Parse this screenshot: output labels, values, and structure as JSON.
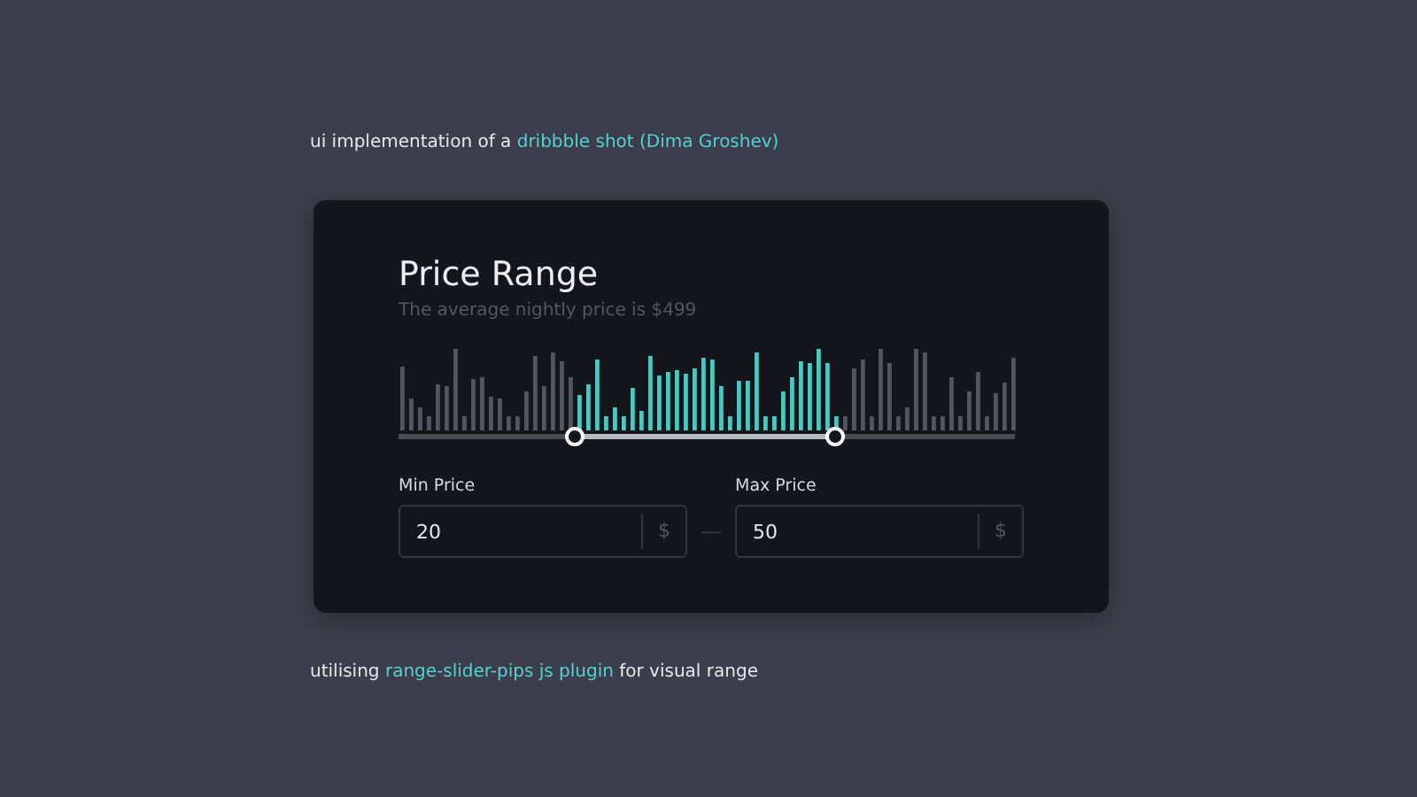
{
  "intro": {
    "before": "ui implementation of a ",
    "link": "dribbble shot (Dima Groshev)"
  },
  "card": {
    "title": "Price Range",
    "subtitle": "The average nightly price is $499",
    "slider": {
      "handles": [
        {
          "level": 0.288
        },
        {
          "level": 0.709
        }
      ]
    },
    "fields": [
      {
        "label": "Min Price",
        "value": "20",
        "unit": "$"
      },
      {
        "label": "Max Price",
        "value": "50",
        "unit": "$"
      }
    ],
    "separator": "—"
  },
  "footer": {
    "before": "utilising ",
    "link": "range-slider-pips js plugin",
    "after": " for visual range"
  }
}
